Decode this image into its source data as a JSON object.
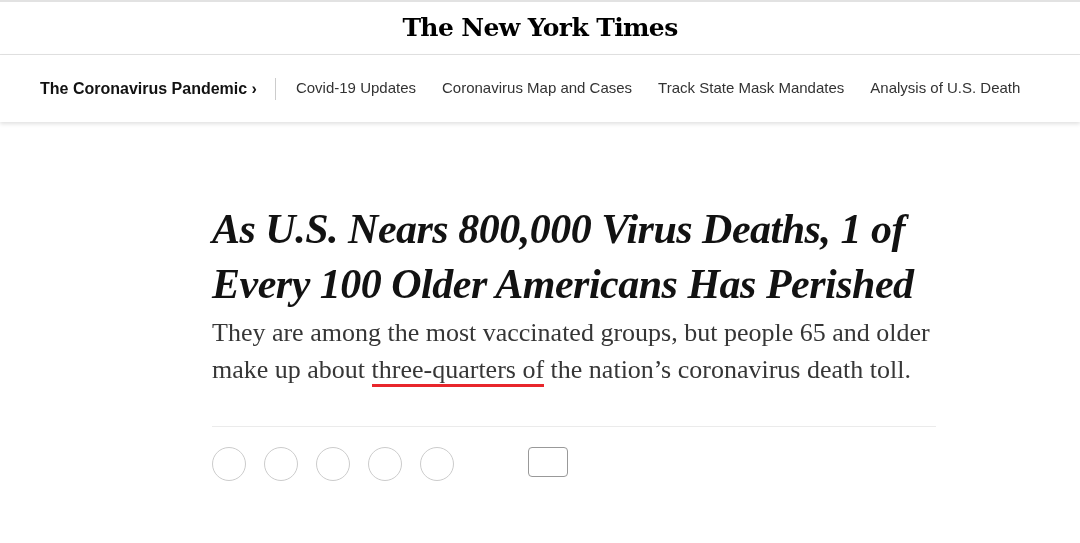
{
  "masthead": {
    "logo": "The New York Times"
  },
  "nav": {
    "section": "The Coronavirus Pandemic ›",
    "links": [
      "Covid-19 Updates",
      "Coronavirus Map and Cases",
      "Track State Mask Mandates",
      "Analysis of U.S. Death"
    ]
  },
  "article": {
    "headline": "As U.S. Nears 800,000 Virus Deaths, 1 of Every 100 Older Americans Has Perished",
    "summary": [
      {
        "text": "They are among the most vaccinated groups, but people 65 and older make up about ",
        "underlined": false
      },
      {
        "text": "three-quarters of",
        "underlined": true
      },
      {
        "text": " the nation’s coronavirus death toll.",
        "underlined": false
      }
    ]
  }
}
